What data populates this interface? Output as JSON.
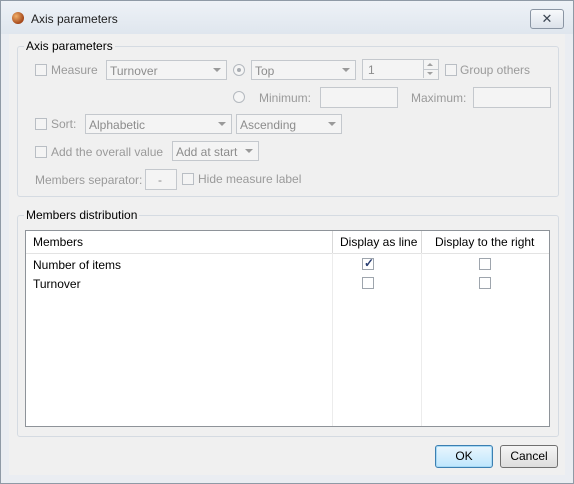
{
  "window": {
    "title": "Axis parameters",
    "close_glyph": "✕"
  },
  "axis_parameters": {
    "group_title": "Axis parameters",
    "measure_label": "Measure",
    "measure_value": "Turnover",
    "top_value": "Top",
    "count_value": "1",
    "group_others_label": "Group others",
    "minimum_label": "Minimum:",
    "minimum_value": "",
    "maximum_label": "Maximum:",
    "maximum_value": "",
    "sort_label": "Sort:",
    "sort_value": "Alphabetic",
    "order_value": "Ascending",
    "overall_label": "Add the overall value",
    "overall_position_value": "Add at start",
    "separator_label": "Members separator:",
    "separator_value": "-",
    "hide_measure_label": "Hide measure label"
  },
  "members_distribution": {
    "group_title": "Members distribution",
    "columns": [
      "Members",
      "Display as line",
      "Display to the right"
    ],
    "rows": [
      {
        "member": "Number of items",
        "display_as_line": true,
        "display_to_right": false
      },
      {
        "member": "Turnover",
        "display_as_line": false,
        "display_to_right": false
      }
    ]
  },
  "buttons": {
    "ok": "OK",
    "cancel": "Cancel"
  },
  "check_glyph": "✓"
}
